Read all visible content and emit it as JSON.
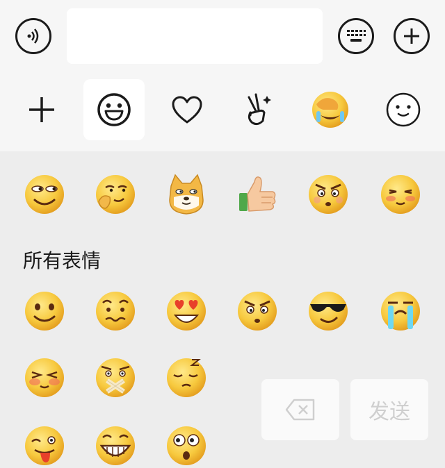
{
  "input": {
    "value": "",
    "placeholder": ""
  },
  "topbar": {
    "left_icon": "voice-icon",
    "right_icons": [
      "keyboard-icon",
      "plus-circle-icon"
    ]
  },
  "tabs": [
    {
      "icon": "add-icon",
      "active": false
    },
    {
      "icon": "smiley-icon",
      "active": true
    },
    {
      "icon": "heart-icon",
      "active": false
    },
    {
      "icon": "victory-hand-icon",
      "active": false
    },
    {
      "icon": "facepalm-laugh-sticker",
      "active": false
    },
    {
      "icon": "simple-smile-icon",
      "active": false
    }
  ],
  "recent_emojis": [
    "smirk-emoji",
    "sly-hand-emoji",
    "doge-emoji",
    "thumbs-up-emoji",
    "angry-emoji",
    "blush-emoji"
  ],
  "section": {
    "title": "所有表情"
  },
  "all_emojis": [
    "smile-emoji",
    "awkward-emoji",
    "heart-eyes-emoji",
    "angry-emoji",
    "cool-emoji",
    "cry-emoji",
    "shy-emoji",
    "shut-mouth-emoji",
    "sleep-emoji",
    "wink-tongue-emoji",
    "grin-emoji",
    "shocked-emoji"
  ],
  "actions": {
    "delete_icon": "backspace-icon",
    "send_label": "发送"
  },
  "colors": {
    "emoji_yellow": "#f5c542",
    "panel_bg": "#ededed",
    "bar_bg": "#f6f6f6",
    "disabled_text": "#cfcfcf"
  }
}
